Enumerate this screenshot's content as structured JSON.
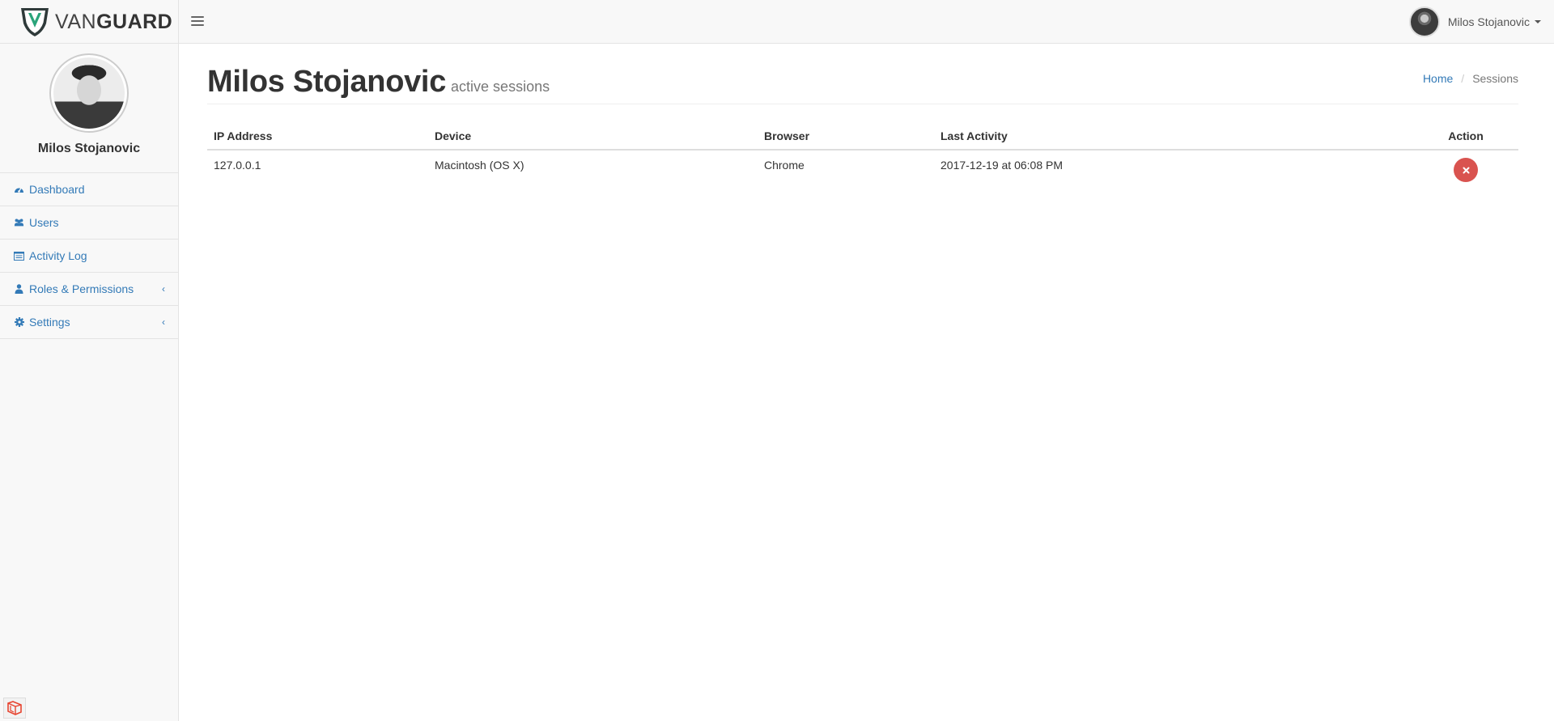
{
  "brand": {
    "name_light": "VAN",
    "name_bold": "GUARD",
    "accent": "#2aa47a"
  },
  "user": {
    "name": "Milos Stojanovic"
  },
  "sidebar": {
    "profile_name": "Milos Stojanovic",
    "items": [
      {
        "label": "Dashboard",
        "icon": "dashboard-icon"
      },
      {
        "label": "Users",
        "icon": "users-icon"
      },
      {
        "label": "Activity Log",
        "icon": "activity-log-icon"
      },
      {
        "label": "Roles & Permissions",
        "icon": "user-icon",
        "expandable": true
      },
      {
        "label": "Settings",
        "icon": "gear-icon",
        "expandable": true
      }
    ]
  },
  "page": {
    "title": "Milos Stojanovic",
    "subtitle": "active sessions"
  },
  "breadcrumb": {
    "home": "Home",
    "current": "Sessions",
    "separator": "/"
  },
  "table": {
    "headers": [
      "IP Address",
      "Device",
      "Browser",
      "Last Activity",
      "Action"
    ],
    "rows": [
      {
        "ip": "127.0.0.1",
        "device": "Macintosh (OS X)",
        "browser": "Chrome",
        "last_activity": "2017-12-19 at 06:08 PM"
      }
    ]
  },
  "colors": {
    "link": "#337ab7",
    "danger": "#d9534f"
  }
}
